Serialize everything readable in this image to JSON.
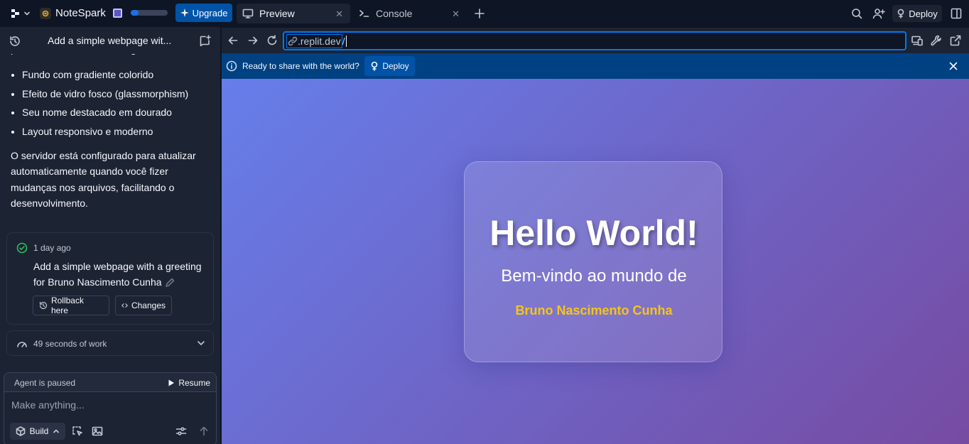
{
  "topbar": {
    "app_name": "NoteSpark",
    "progress_fraction": 0.22,
    "upgrade_label": "Upgrade",
    "tabs": [
      {
        "label": "Preview",
        "icon": "monitor-icon",
        "active": true
      },
      {
        "label": "Console",
        "icon": "terminal-icon",
        "active": false
      }
    ],
    "deploy_label": "Deploy"
  },
  "chat": {
    "title": "Add a simple webpage wit...",
    "cut_line": "pode vê-la rodando. O design inclui:",
    "bullets": [
      "Fundo com gradiente colorido",
      "Efeito de vidro fosco (glassmorphism)",
      "Seu nome destacado em dourado",
      "Layout responsivo e moderno"
    ],
    "paragraph": "O servidor está configurado para atualizar automaticamente quando você fizer mudanças nos arquivos, facilitando o desenvolvimento.",
    "checkpoint": {
      "time": "1 day ago",
      "message": "Add a simple webpage with a greeting for Bruno Nascimento Cunha",
      "rollback_label": "Rollback here",
      "changes_label": "Changes"
    },
    "work_summary": "49 seconds of work",
    "composer": {
      "paused_text": "Agent is paused",
      "resume_label": "Resume",
      "placeholder": "Make anything...",
      "build_label": "Build"
    }
  },
  "preview": {
    "url": ".replit.dev",
    "url_suffix": "/",
    "share_text": "Ready to share with the world?",
    "share_deploy_label": "Deploy",
    "page": {
      "heading": "Hello World!",
      "subtitle": "Bem-vindo ao mundo de",
      "name": "Bruno Nascimento Cunha",
      "gradient_start": "#667eea",
      "gradient_end": "#764ba2",
      "name_color": "#f5c518"
    }
  },
  "colors": {
    "background": "#0e1525",
    "panel": "#1c2333",
    "accent": "#0079f2",
    "banner": "#004182",
    "success": "#2ebd5e"
  }
}
